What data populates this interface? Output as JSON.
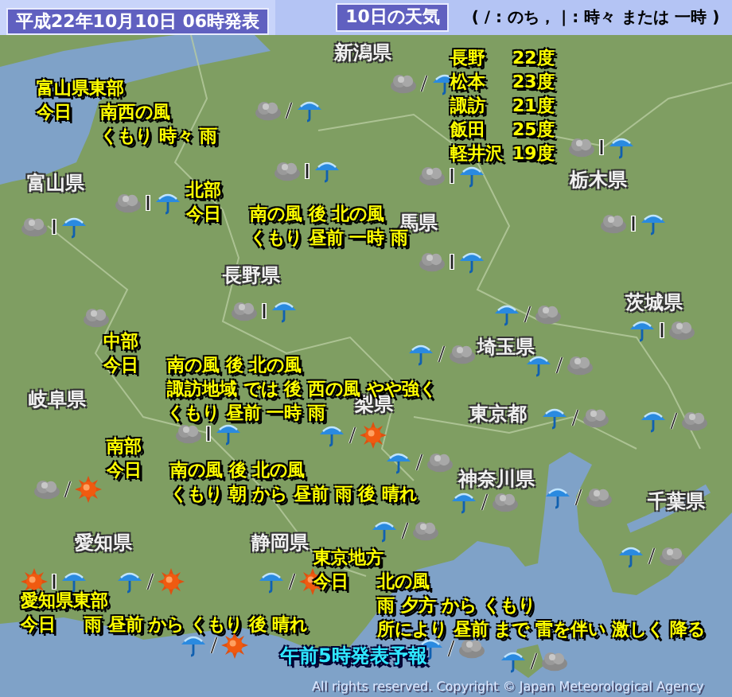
{
  "header": {
    "issued": "平成22年10月10日 06時発表",
    "title": "10日の天気",
    "legend": "( / : のち， | : 時々 または 一時 )"
  },
  "map": {
    "prefectures": [
      "新潟県",
      "富山県",
      "長野県",
      "栃木県",
      "馬県",
      "茨城県",
      "埼玉県",
      "岐阜県",
      "梨県",
      "東京都",
      "神奈川県",
      "千葉県",
      "愛知県",
      "静岡県"
    ],
    "temperatures": [
      {
        "city": "長野",
        "temp": "22度"
      },
      {
        "city": "松本",
        "temp": "23度"
      },
      {
        "city": "諏訪",
        "temp": "21度"
      },
      {
        "city": "飯田",
        "temp": "25度"
      },
      {
        "city": "軽井沢",
        "temp": "19度"
      }
    ],
    "forecasts": [
      {
        "area": "富山県東部",
        "day": "今日",
        "lines": [
          "南西の風",
          "くもり 時々 雨"
        ]
      },
      {
        "area": "北部",
        "day": "今日",
        "lines": [
          "南の風 後 北の風",
          "くもり 昼前 一時 雨"
        ]
      },
      {
        "area": "中部",
        "day": "今日",
        "lines": [
          "南の風 後 北の風",
          "諏訪地域 では 後 西の風 やや強く",
          "くもり 昼前 一時 雨"
        ]
      },
      {
        "area": "南部",
        "day": "今日",
        "lines": [
          "南の風 後 北の風",
          "くもり 朝 から 昼前 雨 後 晴れ"
        ]
      },
      {
        "area": "愛知県東部",
        "day": "今日",
        "lines": [
          "雨 昼前 から くもり 後 晴れ"
        ]
      },
      {
        "area": "東京地方",
        "day": "今日",
        "lines": [
          "北の風",
          "雨 夕方 から くもり",
          "所により 昼前 まで 雷を伴い 激しく 降る"
        ]
      }
    ],
    "symbols": [
      [
        {
          "kind": "cloud"
        },
        {
          "kind": "later"
        },
        {
          "kind": "rain"
        }
      ],
      [
        {
          "kind": "cloud"
        },
        {
          "kind": "later"
        },
        {
          "kind": "rain"
        }
      ],
      [
        {
          "kind": "cloud"
        },
        {
          "kind": "sometimes"
        },
        {
          "kind": "rain"
        }
      ],
      [
        {
          "kind": "cloud"
        },
        {
          "kind": "sometimes"
        },
        {
          "kind": "rain"
        }
      ],
      [
        {
          "kind": "cloud"
        },
        {
          "kind": "sometimes"
        },
        {
          "kind": "rain"
        }
      ],
      [
        {
          "kind": "cloud"
        },
        {
          "kind": "sometimes"
        },
        {
          "kind": "rain"
        }
      ],
      [
        {
          "kind": "cloud"
        },
        {
          "kind": "sometimes"
        },
        {
          "kind": "rain"
        }
      ],
      [
        {
          "kind": "cloud"
        },
        {
          "kind": "sometimes"
        },
        {
          "kind": "rain"
        }
      ],
      [
        {
          "kind": "cloud"
        },
        {
          "kind": "sometimes"
        },
        {
          "kind": "rain"
        }
      ],
      [
        {
          "kind": "cloud"
        },
        {
          "kind": "sometimes"
        },
        {
          "kind": "rain"
        }
      ],
      [
        {
          "kind": "cloud"
        }
      ],
      [
        {
          "kind": "rain"
        },
        {
          "kind": "later"
        },
        {
          "kind": "cloud"
        }
      ],
      [
        {
          "kind": "rain"
        },
        {
          "kind": "sometimes"
        },
        {
          "kind": "cloud"
        }
      ],
      [
        {
          "kind": "rain"
        },
        {
          "kind": "later"
        },
        {
          "kind": "cloud"
        }
      ],
      [
        {
          "kind": "rain"
        },
        {
          "kind": "later"
        },
        {
          "kind": "cloud"
        }
      ],
      [
        {
          "kind": "cloud"
        },
        {
          "kind": "sometimes"
        },
        {
          "kind": "rain"
        }
      ],
      [
        {
          "kind": "rain"
        },
        {
          "kind": "later"
        },
        {
          "kind": "sun"
        }
      ],
      [
        {
          "kind": "cloud"
        },
        {
          "kind": "later"
        },
        {
          "kind": "sun"
        }
      ],
      [
        {
          "kind": "rain"
        },
        {
          "kind": "later"
        },
        {
          "kind": "cloud"
        }
      ],
      [
        {
          "kind": "rain"
        },
        {
          "kind": "later"
        },
        {
          "kind": "cloud"
        }
      ],
      [
        {
          "kind": "rain"
        },
        {
          "kind": "later"
        },
        {
          "kind": "cloud"
        }
      ],
      [
        {
          "kind": "rain"
        },
        {
          "kind": "later"
        },
        {
          "kind": "cloud"
        }
      ],
      [
        {
          "kind": "rain"
        },
        {
          "kind": "later"
        },
        {
          "kind": "cloud"
        }
      ],
      [
        {
          "kind": "sun"
        },
        {
          "kind": "sometimes"
        },
        {
          "kind": "rain"
        }
      ],
      [
        {
          "kind": "rain"
        },
        {
          "kind": "later"
        },
        {
          "kind": "sun"
        }
      ],
      [
        {
          "kind": "rain"
        },
        {
          "kind": "later"
        },
        {
          "kind": "sun"
        }
      ],
      [
        {
          "kind": "rain"
        },
        {
          "kind": "later"
        },
        {
          "kind": "cloud"
        }
      ],
      [
        {
          "kind": "rain"
        },
        {
          "kind": "later"
        },
        {
          "kind": "cloud"
        }
      ],
      [
        {
          "kind": "rain"
        },
        {
          "kind": "later"
        },
        {
          "kind": "cloud"
        }
      ],
      [
        {
          "kind": "rain"
        },
        {
          "kind": "later"
        },
        {
          "kind": "cloud"
        }
      ],
      [
        {
          "kind": "rain"
        },
        {
          "kind": "later"
        },
        {
          "kind": "sun"
        }
      ]
    ],
    "caption": "午前5時発表予報",
    "copyright": "All rights reserved. Copyright © Japan Meteorological Agency"
  }
}
